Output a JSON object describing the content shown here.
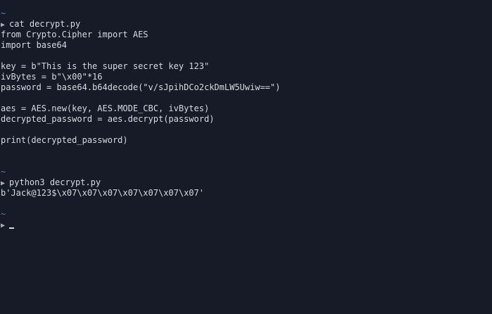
{
  "session1": {
    "dir": "~",
    "command": "cat decrypt.py",
    "output": [
      "from Crypto.Cipher import AES",
      "import base64",
      "",
      "key = b\"This is the super secret key 123\"",
      "ivBytes = b\"\\x00\"*16",
      "password = base64.b64decode(\"v/sJpihDCo2ckDmLW5Uwiw==\")",
      "",
      "aes = AES.new(key, AES.MODE_CBC, ivBytes)",
      "decrypted_password = aes.decrypt(password)",
      "",
      "print(decrypted_password)"
    ]
  },
  "session2": {
    "dir": "~",
    "command": "python3 decrypt.py",
    "output": "b'Jack@123$\\x07\\x07\\x07\\x07\\x07\\x07\\x07'"
  },
  "session3": {
    "dir": "~",
    "command": ""
  },
  "prompt_symbol": "▶",
  "colors": {
    "background": "#161b27",
    "text": "#d5d9e0",
    "dir": "#4f82c6"
  }
}
